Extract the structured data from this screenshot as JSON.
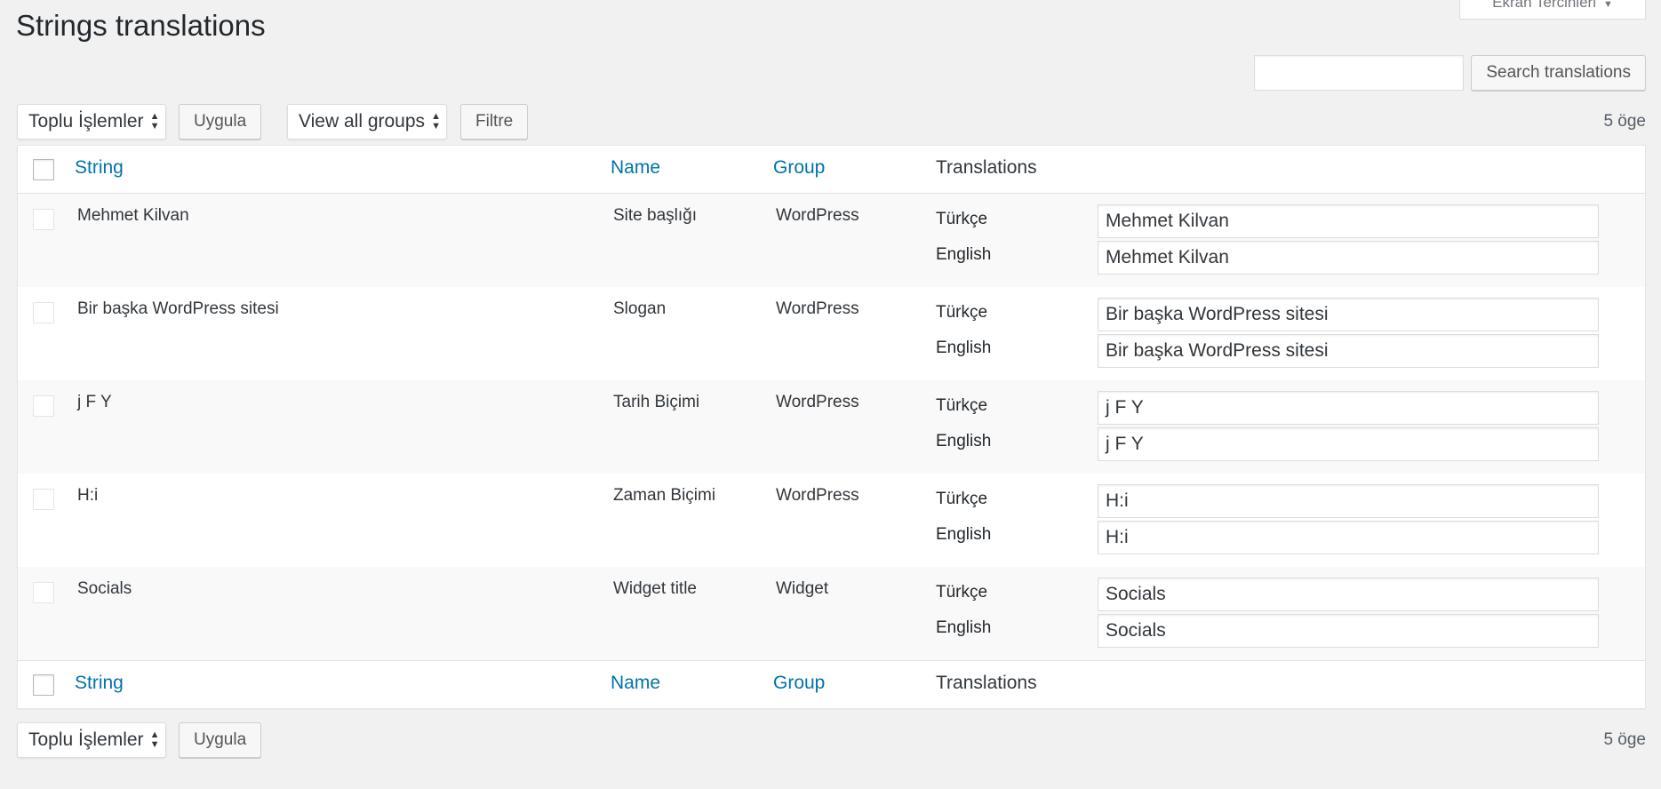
{
  "screen_options": {
    "label": "Ekran Tercihleri",
    "caret": "▼"
  },
  "page": {
    "title": "Strings translations"
  },
  "search": {
    "value": "",
    "button_label": "Search translations"
  },
  "tablenav_top": {
    "bulk_actions": "Toplu İşlemler",
    "apply": "Uygula",
    "group_filter": "View all groups",
    "filter_button": "Filtre",
    "count": "5 öge"
  },
  "tablenav_bottom": {
    "bulk_actions": "Toplu İşlemler",
    "apply": "Uygula",
    "count": "5 öge"
  },
  "columns": {
    "string": "String",
    "name": "Name",
    "group": "Group",
    "translations": "Translations"
  },
  "rows": [
    {
      "string": "Mehmet Kilvan",
      "name": "Site başlığı",
      "group": "WordPress",
      "translations": [
        {
          "lang": "Türkçe",
          "value": "Mehmet Kilvan"
        },
        {
          "lang": "English",
          "value": "Mehmet Kilvan"
        }
      ]
    },
    {
      "string": "Bir başka WordPress sitesi",
      "name": "Slogan",
      "group": "WordPress",
      "translations": [
        {
          "lang": "Türkçe",
          "value": "Bir başka WordPress sitesi"
        },
        {
          "lang": "English",
          "value": "Bir başka WordPress sitesi"
        }
      ]
    },
    {
      "string": "j F Y",
      "name": "Tarih Biçimi",
      "group": "WordPress",
      "translations": [
        {
          "lang": "Türkçe",
          "value": "j F Y"
        },
        {
          "lang": "English",
          "value": "j F Y"
        }
      ]
    },
    {
      "string": "H:i",
      "name": "Zaman Biçimi",
      "group": "WordPress",
      "translations": [
        {
          "lang": "Türkçe",
          "value": "H:i"
        },
        {
          "lang": "English",
          "value": "H:i"
        }
      ]
    },
    {
      "string": "Socials",
      "name": "Widget title",
      "group": "Widget",
      "translations": [
        {
          "lang": "Türkçe",
          "value": "Socials"
        },
        {
          "lang": "English",
          "value": "Socials"
        }
      ]
    }
  ],
  "colors": {
    "link": "#0073aa",
    "background": "#f1f1f1",
    "alt_row": "#f9f9f9"
  }
}
